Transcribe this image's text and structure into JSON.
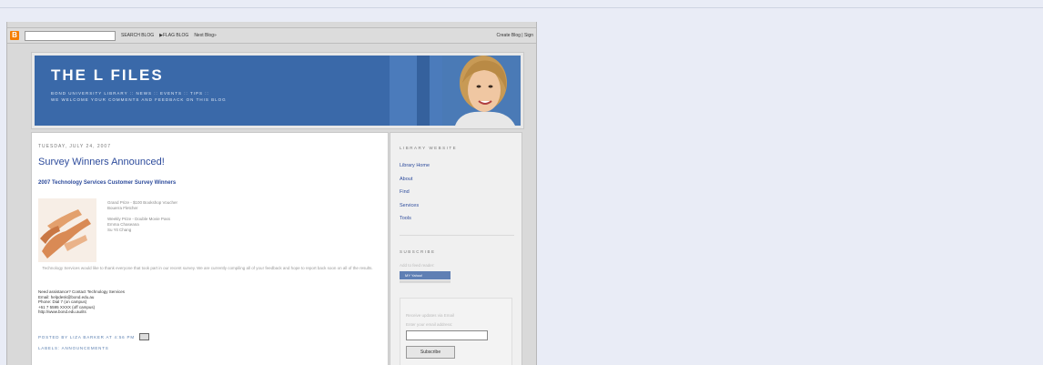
{
  "navbar": {
    "search_button": "SEARCH BLOG",
    "flag_button": "▶FLAG BLOG",
    "next_blog": "Next Blog»",
    "right_links": "Create Blog | Sign"
  },
  "header": {
    "title": "THE L FILES",
    "tagline_line1": "BOND UNIVERSITY LIBRARY :: NEWS :: EVENTS :: TIPS ::",
    "tagline_line2": "WE WELCOME YOUR COMMENTS AND FEEDBACK ON THIS BLOG"
  },
  "post": {
    "date": "TUESDAY, JULY 24, 2007",
    "title": "Survey Winners Announced!",
    "subtitle": "2007 Technology Services Customer Survey Winners",
    "grand_prize": "Grand Prize - $100 Bookshop Voucher",
    "grand_winner": "Bouerra Fletcher",
    "weekly_prize": "Weekly Prize - Double Movie Pass",
    "weekly_winner1": "Emma Chaseana",
    "weekly_winner2": "Su Yit Chang",
    "paragraph": "Technology Services would like to thank everyone that took part in our recent survey. We are currently compiling all of your feedback and hope to report back soon on all of the results.",
    "contact": [
      "Need assistance? Contact Technology Services",
      "Email: helpdesk@bond.edu.au",
      "Phone: Dial 7 (on campus)",
      "+61 7 5595 XXXX (off campus)",
      "http://www.bond.edu.au/its"
    ],
    "posted_by": "POSTED BY LIZA BARKER AT 4:56 PM",
    "labels": "LABELS: ANNOUNCEMENTS"
  },
  "sidebar": {
    "website_heading": "LIBRARY WEBSITE",
    "links": [
      "Library Home",
      "About",
      "Find",
      "Services",
      "Tools"
    ],
    "subscribe_heading": "SUBSCRIBE",
    "feed_text": "Add to feed reader:",
    "feed_button": "MY Yahoo!",
    "email_line1": "Receive updates via Email",
    "email_line2": "Enter your email address:",
    "subscribe_button": "Subscribe"
  },
  "colors": {
    "header_blue": "#3a69a9",
    "link_blue": "#2e4c9c",
    "blogger_orange": "#f57d00"
  }
}
